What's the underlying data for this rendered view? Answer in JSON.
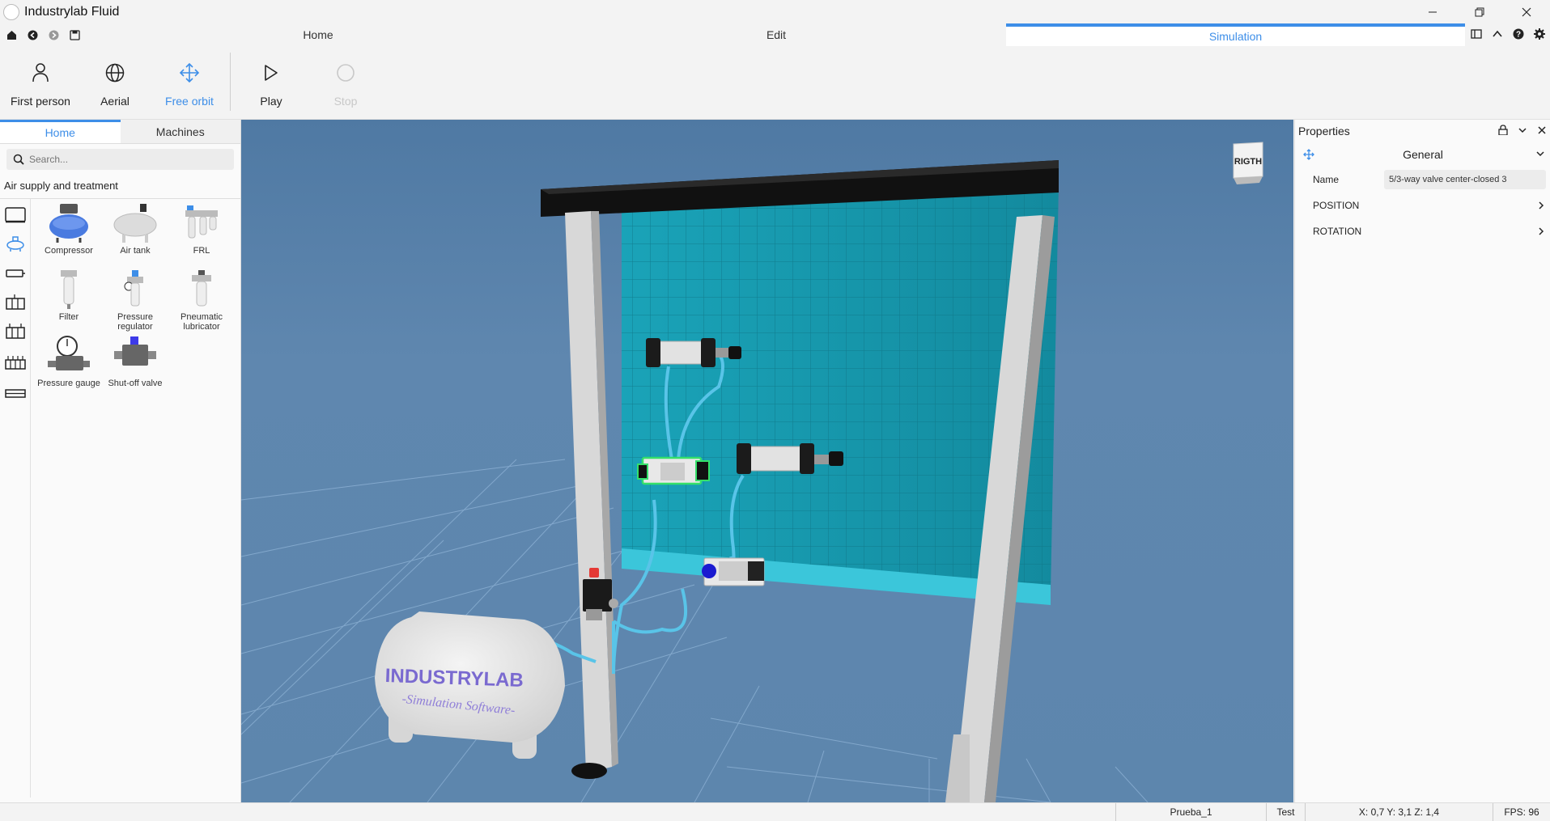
{
  "app": {
    "title": "Industrylab Fluid"
  },
  "tabs": {
    "home": "Home",
    "edit": "Edit",
    "simulation": "Simulation"
  },
  "ribbon": {
    "first_person": "First person",
    "aerial": "Aerial",
    "free_orbit": "Free orbit",
    "play": "Play",
    "stop": "Stop"
  },
  "left_panel": {
    "tabs": {
      "home": "Home",
      "machines": "Machines"
    },
    "search_placeholder": "Search...",
    "category_title": "Air supply and treatment",
    "items": [
      {
        "label": "Compressor"
      },
      {
        "label": "Air tank"
      },
      {
        "label": "FRL"
      },
      {
        "label": "Filter"
      },
      {
        "label": "Pressure regulator"
      },
      {
        "label": "Pneumatic lubricator"
      },
      {
        "label": "Pressure gauge"
      },
      {
        "label": "Shut-off valve"
      }
    ]
  },
  "viewport": {
    "view_cube_label": "RIGTH",
    "tank_brand": "INDUSTRYLAB",
    "tank_subtitle": "-Simulation Software-"
  },
  "properties": {
    "title": "Properties",
    "section": "General",
    "name_label": "Name",
    "name_value": "5/3-way valve center-closed 3",
    "position_label": "POSITION",
    "rotation_label": "ROTATION"
  },
  "status": {
    "project": "Prueba_1",
    "mode": "Test",
    "coords": "X: 0,7  Y: 3,1  Z: 1,4",
    "fps": "FPS: 96"
  },
  "colors": {
    "accent": "#3d8ee8",
    "panel_cyan": "#1a9bb0",
    "sky": "#5a82aa",
    "tube": "#59c4e8",
    "selection": "#35e06a"
  }
}
